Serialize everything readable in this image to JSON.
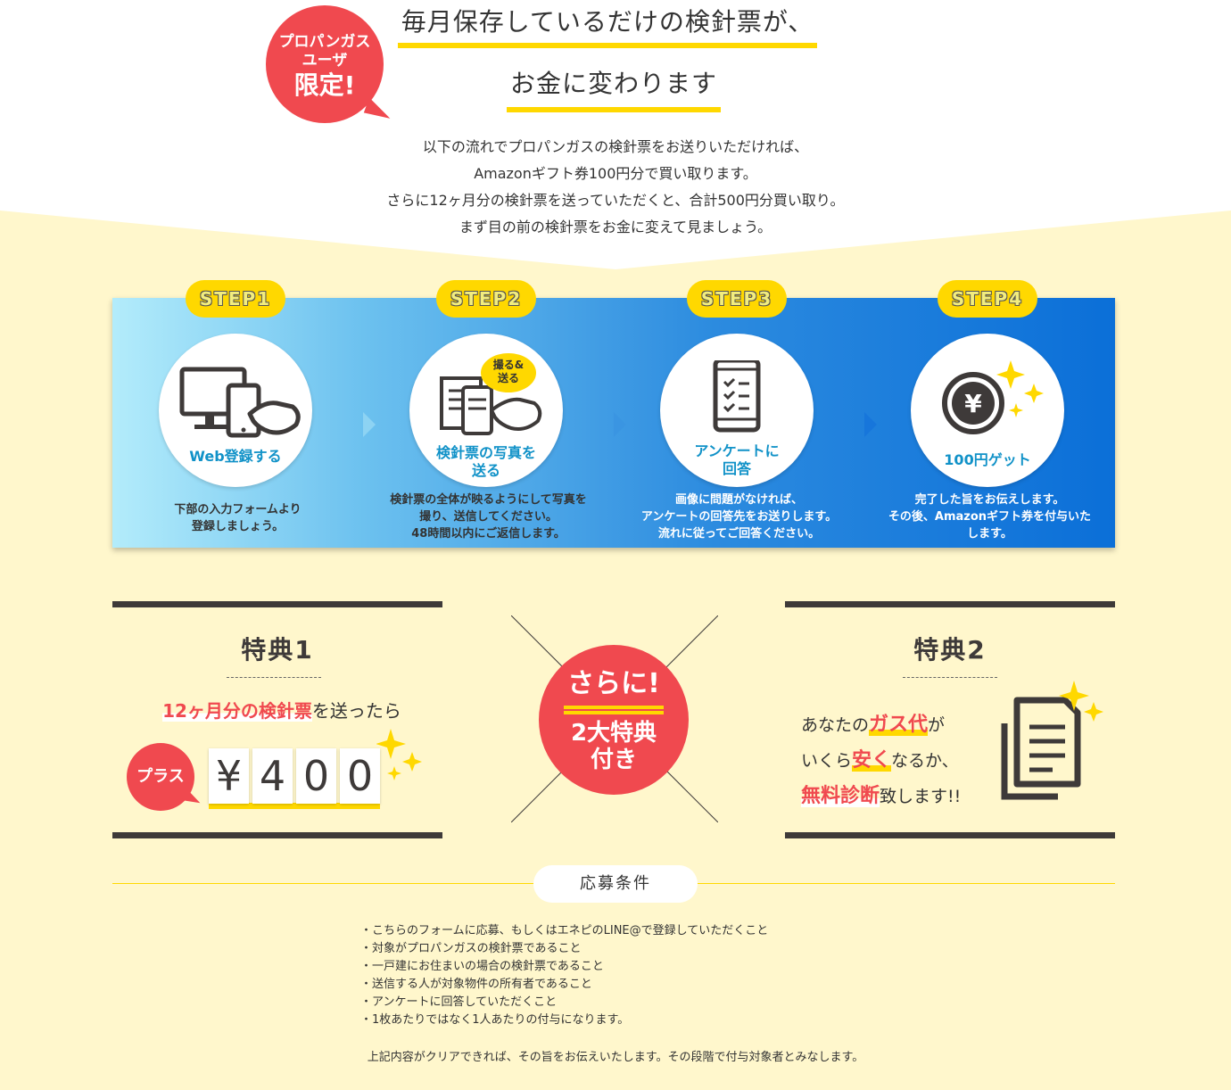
{
  "header": {
    "badge": {
      "line1": "プロパンガス",
      "line2": "ユーザ",
      "line3": "限定!"
    },
    "title_line1": "毎月保存しているだけの検針票が、",
    "title_line2": "お金に変わります",
    "intro": [
      "以下の流れでプロパンガスの検針票をお送りいただければ、",
      "Amazonギフト券100円分で買い取ります。",
      "さらに12ヶ月分の検針票を送っていただくと、合計500円分買い取り。",
      "まず目の前の検針票をお金に変えて見ましょう。"
    ]
  },
  "steps": [
    {
      "tab": "STEP1",
      "label": [
        "Web登録する"
      ],
      "desc": [
        "下部の入力フォームより",
        "登録しましょう。"
      ],
      "icon": "devices-hand-icon"
    },
    {
      "tab": "STEP2",
      "label": [
        "検針票の写真を",
        "送る"
      ],
      "desc": [
        "検針票の全体が映るようにして写真を",
        "撮り、送信してください。",
        "48時間以内にご返信します。"
      ],
      "icon": "phone-receipt-icon",
      "badge": [
        "撮る&",
        "送る"
      ]
    },
    {
      "tab": "STEP3",
      "label": [
        "アンケートに",
        "回答"
      ],
      "desc": [
        "画像に問題がなければ、",
        "アンケートの回答先をお送りします。",
        "流れに従ってご回答ください。"
      ],
      "icon": "checklist-phone-icon"
    },
    {
      "tab": "STEP4",
      "label": [
        "100円ゲット"
      ],
      "desc": [
        "完了した旨をお伝えします。",
        "その後、Amazonギフト券を付与いた",
        "します。"
      ],
      "icon": "yen-coin-icon"
    }
  ],
  "benefit1": {
    "title": "特典1",
    "text_red1": "12ヶ月分",
    "text_mid": "の",
    "text_red2": "検針票",
    "text_tail": "を送ったら",
    "plus": "プラス",
    "digits": [
      "¥",
      "4",
      "0",
      "0"
    ]
  },
  "center": {
    "line1": "さらに!",
    "line2": "2大特典",
    "line3": "付き"
  },
  "benefit2": {
    "title": "特典2",
    "l1_pre": "あなたの",
    "l1_red": "ガス代",
    "l1_post": "が",
    "l2_pre": "いくら",
    "l2_red": "安く",
    "l2_post": "なるか、",
    "l3_red": "無料診断",
    "l3_post": "致します!!"
  },
  "conditions": {
    "title": "応募条件",
    "items": [
      "こちらのフォームに応募、もしくはエネピのLINE@で登録していただくこと",
      "対象がプロパンガスの検針票であること",
      "一戸建にお住まいの場合の検針票であること",
      "送信する人が対象物件の所有者であること",
      "アンケートに回答していただくこと",
      "1枚あたりではなく1人あたりの付与になります。"
    ],
    "note": "上記内容がクリアできれば、その旨をお伝えいたします。その段階で付与対象者とみなします。"
  },
  "colors": {
    "accent_yellow": "#ffd800",
    "accent_red": "#f0494f",
    "bg_cream": "#fff7cc",
    "label_blue": "#1192c8",
    "dark": "#3e3a39"
  }
}
